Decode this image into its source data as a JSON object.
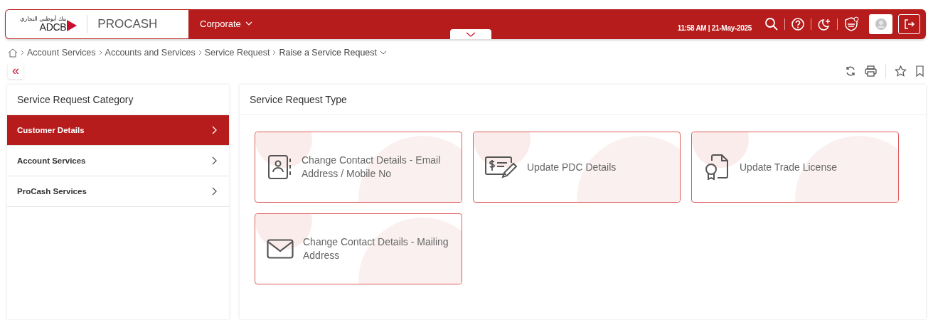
{
  "header": {
    "logo_arabic": "بنك أبوظبي التجاري",
    "logo_text": "ADCB",
    "product": "PROCASH",
    "menu": "Corporate",
    "datetime": "11:58 AM | 21-May-2025"
  },
  "breadcrumb": [
    "Account Services",
    "Accounts and Services",
    "Service Request",
    "Raise a Service Request"
  ],
  "collapse_label": "«",
  "sidebar": {
    "title": "Service Request Category",
    "items": [
      {
        "label": "Customer Details",
        "selected": true
      },
      {
        "label": "Account Services",
        "selected": false
      },
      {
        "label": "ProCash Services",
        "selected": false
      }
    ]
  },
  "main": {
    "title": "Service Request Type",
    "cards": [
      {
        "kind": "contact",
        "label": "Change Contact Details - Email Address / Mobile No"
      },
      {
        "kind": "cheque",
        "label": "Update PDC Details"
      },
      {
        "kind": "license",
        "label": "Update Trade License"
      },
      {
        "kind": "mail",
        "label": "Change Contact Details - Mailing Address"
      }
    ]
  }
}
